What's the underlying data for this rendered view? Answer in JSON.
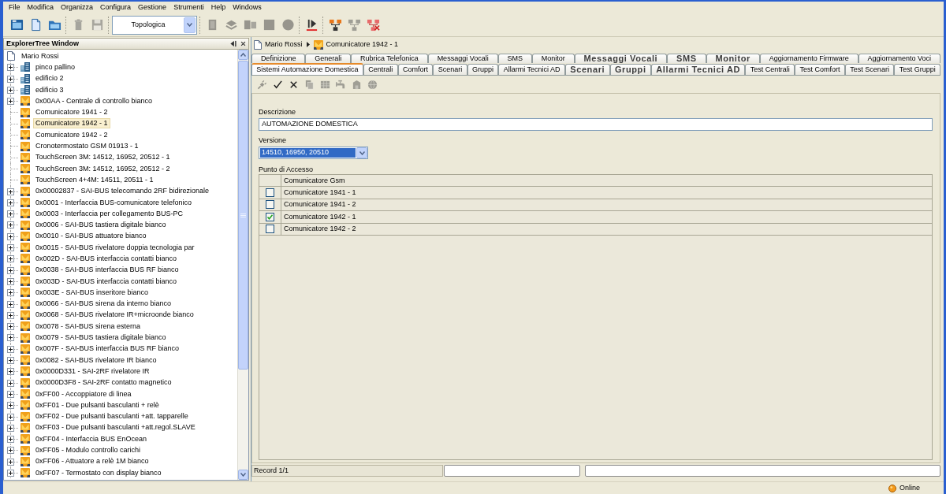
{
  "menu_bar": [
    "File",
    "Modifica",
    "Organizza",
    "Configura",
    "Gestione",
    "Strumenti",
    "Help",
    "Windows"
  ],
  "toolbar": {
    "items": [
      {
        "kind": "button",
        "disabled": false
      },
      {
        "kind": "button",
        "disabled": false
      },
      {
        "kind": "button",
        "disabled": false
      },
      {
        "kind": "separator"
      },
      {
        "kind": "button",
        "disabled": true
      },
      {
        "kind": "button",
        "disabled": true
      },
      {
        "kind": "separator"
      },
      {
        "kind": "select",
        "value": "Topologica"
      },
      {
        "kind": "separator"
      },
      {
        "kind": "button",
        "disabled": true
      },
      {
        "kind": "button",
        "disabled": true
      },
      {
        "kind": "button",
        "disabled": true
      },
      {
        "kind": "button",
        "disabled": true
      },
      {
        "kind": "button",
        "disabled": true
      },
      {
        "kind": "separator"
      },
      {
        "kind": "button",
        "disabled": false
      },
      {
        "kind": "separator"
      },
      {
        "kind": "button",
        "disabled": false
      },
      {
        "kind": "button",
        "disabled": true
      },
      {
        "kind": "button",
        "disabled": false
      }
    ]
  },
  "explorer": {
    "title": "ExplorerTree Window",
    "tree": {
      "label": "Mario Rossi",
      "selected": false,
      "children": [
        {
          "label": "pinco pallino",
          "kind": "building",
          "selected": false
        },
        {
          "label": "edificio 2",
          "kind": "building",
          "selected": false
        },
        {
          "label": "edificio 3",
          "kind": "building",
          "selected": false
        },
        {
          "label": "0x00AA - Centrale di controllo bianco",
          "kind": "device",
          "selected": false
        },
        {
          "label": "Comunicatore 1941 - 2",
          "kind": "leaf",
          "selected": false
        },
        {
          "label": "Comunicatore 1942 - 1",
          "kind": "leaf",
          "selected": true
        },
        {
          "label": "Comunicatore 1942 - 2",
          "kind": "leaf",
          "selected": false
        },
        {
          "label": "Cronotermostato GSM 01913 - 1",
          "kind": "leaf",
          "selected": false
        },
        {
          "label": "TouchScreen 3M: 14512, 16952, 20512 - 1",
          "kind": "leaf",
          "selected": false
        },
        {
          "label": "TouchScreen 3M: 14512, 16952, 20512 - 2",
          "kind": "leaf",
          "selected": false
        },
        {
          "label": "TouchScreen 4+4M: 14511, 20511 - 1",
          "kind": "leaf",
          "selected": false
        },
        {
          "label": "0x00002837 - SAI-BUS telecomando 2RF bidirezionale",
          "kind": "device",
          "selected": false
        },
        {
          "label": "0x0001 - Interfaccia BUS-comunicatore telefonico",
          "kind": "device",
          "selected": false
        },
        {
          "label": "0x0003 - Interfaccia per collegamento BUS-PC",
          "kind": "device",
          "selected": false
        },
        {
          "label": "0x0006 - SAI-BUS tastiera digitale bianco",
          "kind": "device",
          "selected": false
        },
        {
          "label": "0x0010 - SAI-BUS attuatore bianco",
          "kind": "device",
          "selected": false
        },
        {
          "label": "0x0015 - SAI-BUS rivelatore doppia tecnologia par",
          "kind": "device",
          "selected": false
        },
        {
          "label": "0x002D - SAI-BUS interfaccia contatti bianco",
          "kind": "device",
          "selected": false
        },
        {
          "label": "0x0038 - SAI-BUS interfaccia BUS RF bianco",
          "kind": "device",
          "selected": false
        },
        {
          "label": "0x003D - SAI-BUS interfaccia contatti bianco",
          "kind": "device",
          "selected": false
        },
        {
          "label": "0x003E - SAI-BUS inseritore bianco",
          "kind": "device",
          "selected": false
        },
        {
          "label": "0x0066 - SAI-BUS sirena da interno bianco",
          "kind": "device",
          "selected": false
        },
        {
          "label": "0x0068 - SAI-BUS rivelatore IR+microonde bianco",
          "kind": "device",
          "selected": false
        },
        {
          "label": "0x0078 - SAI-BUS sirena esterna",
          "kind": "device",
          "selected": false
        },
        {
          "label": "0x0079 - SAI-BUS tastiera digitale bianco",
          "kind": "device",
          "selected": false
        },
        {
          "label": "0x007F - SAI-BUS interfaccia BUS RF bianco",
          "kind": "device",
          "selected": false
        },
        {
          "label": "0x0082 - SAI-BUS rivelatore IR bianco",
          "kind": "device",
          "selected": false
        },
        {
          "label": "0x0000D331 - SAI-2RF rivelatore IR",
          "kind": "device",
          "selected": false
        },
        {
          "label": "0x0000D3F8 - SAI-2RF contatto magnetico",
          "kind": "device",
          "selected": false
        },
        {
          "label": "0xFF00 - Accoppiatore di linea",
          "kind": "device",
          "selected": false
        },
        {
          "label": "0xFF01 - Due pulsanti basculanti + relè",
          "kind": "device",
          "selected": false
        },
        {
          "label": "0xFF02 - Due pulsanti basculanti +att. tapparelle",
          "kind": "device",
          "selected": false
        },
        {
          "label": "0xFF03 - Due pulsanti basculanti +att.regol.SLAVE",
          "kind": "device",
          "selected": false
        },
        {
          "label": "0xFF04 - Interfaccia BUS EnOcean",
          "kind": "device",
          "selected": false
        },
        {
          "label": "0xFF05 - Modulo controllo carichi",
          "kind": "device",
          "selected": false
        },
        {
          "label": "0xFF06 - Attuatore a relè 1M bianco",
          "kind": "device",
          "selected": false
        },
        {
          "label": "0xFF07 - Termostato con display bianco",
          "kind": "device",
          "selected": false
        }
      ]
    }
  },
  "breadcrumb": [
    {
      "label": "Mario Rossi",
      "kind": "document"
    },
    {
      "label": "Comunicatore 1942 - 1",
      "kind": "device"
    }
  ],
  "tab_rows": [
    {
      "tabs": [
        {
          "label": "Definizione",
          "kind": "normal",
          "selected": false
        },
        {
          "label": "Generali",
          "kind": "normal",
          "selected": false
        },
        {
          "label": "Rubrica Telefonica",
          "kind": "normal",
          "selected": false
        },
        {
          "label": "Messaggi Vocali",
          "kind": "normal",
          "selected": false
        },
        {
          "label": "SMS",
          "kind": "normal",
          "selected": false
        },
        {
          "label": "Monitor",
          "kind": "normal",
          "selected": false
        },
        {
          "label": "Messaggi Vocali",
          "kind": "large",
          "selected": false
        },
        {
          "label": "SMS",
          "kind": "large",
          "selected": false
        },
        {
          "label": "Monitor",
          "kind": "large",
          "selected": false
        },
        {
          "label": "Aggiornamento Firmware",
          "kind": "normal",
          "selected": false
        },
        {
          "label": "Aggiornamento Voci",
          "kind": "normal",
          "selected": false
        }
      ]
    },
    {
      "tabs": [
        {
          "label": "Sistemi Automazione Domestica",
          "kind": "normal",
          "selected": true
        },
        {
          "label": "Centrali",
          "kind": "normal",
          "selected": false
        },
        {
          "label": "Comfort",
          "kind": "normal",
          "selected": false
        },
        {
          "label": "Scenari",
          "kind": "normal",
          "selected": false
        },
        {
          "label": "Gruppi",
          "kind": "normal",
          "selected": false
        },
        {
          "label": "Allarmi Tecnici AD",
          "kind": "normal",
          "selected": false
        },
        {
          "label": "Scenari",
          "kind": "large",
          "selected": false
        },
        {
          "label": "Gruppi",
          "kind": "large",
          "selected": false
        },
        {
          "label": "Allarmi Tecnici AD",
          "kind": "large",
          "selected": false
        },
        {
          "label": "Test Centrali",
          "kind": "normal",
          "selected": false
        },
        {
          "label": "Test Comfort",
          "kind": "normal",
          "selected": false
        },
        {
          "label": "Test Scenari",
          "kind": "normal",
          "selected": false
        },
        {
          "label": "Test Gruppi",
          "kind": "normal",
          "selected": false
        }
      ]
    }
  ],
  "form_toolbar": {
    "buttons": [
      {
        "disabled": true
      },
      {
        "disabled": false
      },
      {
        "disabled": false
      },
      {
        "disabled": true
      },
      {
        "disabled": true
      },
      {
        "disabled": true
      },
      {
        "disabled": true
      },
      {
        "disabled": true
      }
    ]
  },
  "form": {
    "description": {
      "label": "Descrizione",
      "value": "AUTOMAZIONE DOMESTICA"
    },
    "version": {
      "label": "Versione",
      "value": "14510, 16950, 20510"
    },
    "access_point": {
      "label": "Punto di Accesso",
      "columns": [
        "Comunicatore Gsm"
      ],
      "rows": [
        {
          "label": "Comunicatore 1941 - 1",
          "checked": false
        },
        {
          "label": "Comunicatore 1941 - 2",
          "checked": false
        },
        {
          "label": "Comunicatore 1942 - 1",
          "checked": true
        },
        {
          "label": "Comunicatore 1942 - 2",
          "checked": false
        }
      ]
    }
  },
  "record_bar": {
    "text": "Record 1/1"
  },
  "status_bar": {
    "status": "Online"
  }
}
